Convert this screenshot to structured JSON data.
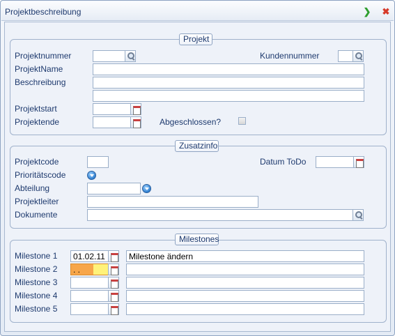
{
  "window": {
    "title": "Projektbeschreibung",
    "ok_icon": "green-arrow-right-icon",
    "close_icon": "red-x-icon"
  },
  "projekt": {
    "legend": "Projekt",
    "projektnummer_label": "Projektnummer",
    "projektnummer_value": "",
    "kundennummer_label": "Kundennummer",
    "kundennummer_value": "",
    "projektname_label": "ProjektName",
    "projektname_value": "",
    "beschreibung_label": "Beschreibung",
    "beschreibung_value1": "",
    "beschreibung_value2": "",
    "projektstart_label": "Projektstart",
    "projektstart_value": "",
    "projektende_label": "Projektende",
    "projektende_value": "",
    "abgeschlossen_label": "Abgeschlossen?",
    "abgeschlossen_checked": false
  },
  "zusatzinfo": {
    "legend": "Zusatzinfo",
    "projektcode_label": "Projektcode",
    "projektcode_value": "",
    "datum_todo_label": "Datum ToDo",
    "datum_todo_value": "",
    "prioritaetscode_label": "Prioritätscode",
    "abteilung_label": "Abteilung",
    "abteilung_value": "",
    "projektleiter_label": "Projektleiter",
    "projektleiter_value": "",
    "dokumente_label": "Dokumente",
    "dokumente_value": ""
  },
  "milestones": {
    "legend": "Milestones",
    "items": [
      {
        "label": "Milestone 1",
        "date": "01.02.11",
        "text": "Milestone ändern"
      },
      {
        "label": "Milestone 2",
        "date": " .  .",
        "text": ""
      },
      {
        "label": "Milestone 3",
        "date": "",
        "text": ""
      },
      {
        "label": "Milestone 4",
        "date": "",
        "text": ""
      },
      {
        "label": "Milestone 5",
        "date": "",
        "text": ""
      }
    ]
  },
  "colors": {
    "accent": "#1e3a6e",
    "active_field_left": "#f7a64a",
    "active_field_right": "#fff27a",
    "ok": "#2e9e2e",
    "close": "#d63a2a"
  }
}
